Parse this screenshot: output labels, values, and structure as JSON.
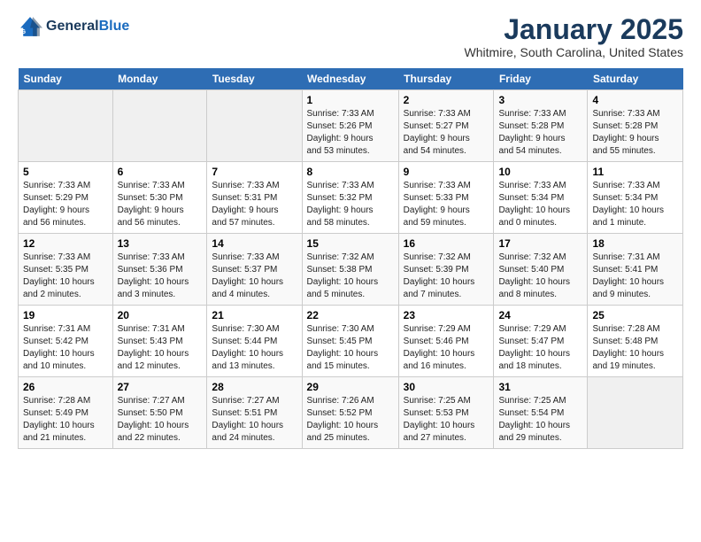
{
  "header": {
    "logo_line1": "General",
    "logo_line2": "Blue",
    "month_title": "January 2025",
    "location": "Whitmire, South Carolina, United States"
  },
  "weekdays": [
    "Sunday",
    "Monday",
    "Tuesday",
    "Wednesday",
    "Thursday",
    "Friday",
    "Saturday"
  ],
  "weeks": [
    [
      {
        "num": "",
        "info": ""
      },
      {
        "num": "",
        "info": ""
      },
      {
        "num": "",
        "info": ""
      },
      {
        "num": "1",
        "info": "Sunrise: 7:33 AM\nSunset: 5:26 PM\nDaylight: 9 hours\nand 53 minutes."
      },
      {
        "num": "2",
        "info": "Sunrise: 7:33 AM\nSunset: 5:27 PM\nDaylight: 9 hours\nand 54 minutes."
      },
      {
        "num": "3",
        "info": "Sunrise: 7:33 AM\nSunset: 5:28 PM\nDaylight: 9 hours\nand 54 minutes."
      },
      {
        "num": "4",
        "info": "Sunrise: 7:33 AM\nSunset: 5:28 PM\nDaylight: 9 hours\nand 55 minutes."
      }
    ],
    [
      {
        "num": "5",
        "info": "Sunrise: 7:33 AM\nSunset: 5:29 PM\nDaylight: 9 hours\nand 56 minutes."
      },
      {
        "num": "6",
        "info": "Sunrise: 7:33 AM\nSunset: 5:30 PM\nDaylight: 9 hours\nand 56 minutes."
      },
      {
        "num": "7",
        "info": "Sunrise: 7:33 AM\nSunset: 5:31 PM\nDaylight: 9 hours\nand 57 minutes."
      },
      {
        "num": "8",
        "info": "Sunrise: 7:33 AM\nSunset: 5:32 PM\nDaylight: 9 hours\nand 58 minutes."
      },
      {
        "num": "9",
        "info": "Sunrise: 7:33 AM\nSunset: 5:33 PM\nDaylight: 9 hours\nand 59 minutes."
      },
      {
        "num": "10",
        "info": "Sunrise: 7:33 AM\nSunset: 5:34 PM\nDaylight: 10 hours\nand 0 minutes."
      },
      {
        "num": "11",
        "info": "Sunrise: 7:33 AM\nSunset: 5:34 PM\nDaylight: 10 hours\nand 1 minute."
      }
    ],
    [
      {
        "num": "12",
        "info": "Sunrise: 7:33 AM\nSunset: 5:35 PM\nDaylight: 10 hours\nand 2 minutes."
      },
      {
        "num": "13",
        "info": "Sunrise: 7:33 AM\nSunset: 5:36 PM\nDaylight: 10 hours\nand 3 minutes."
      },
      {
        "num": "14",
        "info": "Sunrise: 7:33 AM\nSunset: 5:37 PM\nDaylight: 10 hours\nand 4 minutes."
      },
      {
        "num": "15",
        "info": "Sunrise: 7:32 AM\nSunset: 5:38 PM\nDaylight: 10 hours\nand 5 minutes."
      },
      {
        "num": "16",
        "info": "Sunrise: 7:32 AM\nSunset: 5:39 PM\nDaylight: 10 hours\nand 7 minutes."
      },
      {
        "num": "17",
        "info": "Sunrise: 7:32 AM\nSunset: 5:40 PM\nDaylight: 10 hours\nand 8 minutes."
      },
      {
        "num": "18",
        "info": "Sunrise: 7:31 AM\nSunset: 5:41 PM\nDaylight: 10 hours\nand 9 minutes."
      }
    ],
    [
      {
        "num": "19",
        "info": "Sunrise: 7:31 AM\nSunset: 5:42 PM\nDaylight: 10 hours\nand 10 minutes."
      },
      {
        "num": "20",
        "info": "Sunrise: 7:31 AM\nSunset: 5:43 PM\nDaylight: 10 hours\nand 12 minutes."
      },
      {
        "num": "21",
        "info": "Sunrise: 7:30 AM\nSunset: 5:44 PM\nDaylight: 10 hours\nand 13 minutes."
      },
      {
        "num": "22",
        "info": "Sunrise: 7:30 AM\nSunset: 5:45 PM\nDaylight: 10 hours\nand 15 minutes."
      },
      {
        "num": "23",
        "info": "Sunrise: 7:29 AM\nSunset: 5:46 PM\nDaylight: 10 hours\nand 16 minutes."
      },
      {
        "num": "24",
        "info": "Sunrise: 7:29 AM\nSunset: 5:47 PM\nDaylight: 10 hours\nand 18 minutes."
      },
      {
        "num": "25",
        "info": "Sunrise: 7:28 AM\nSunset: 5:48 PM\nDaylight: 10 hours\nand 19 minutes."
      }
    ],
    [
      {
        "num": "26",
        "info": "Sunrise: 7:28 AM\nSunset: 5:49 PM\nDaylight: 10 hours\nand 21 minutes."
      },
      {
        "num": "27",
        "info": "Sunrise: 7:27 AM\nSunset: 5:50 PM\nDaylight: 10 hours\nand 22 minutes."
      },
      {
        "num": "28",
        "info": "Sunrise: 7:27 AM\nSunset: 5:51 PM\nDaylight: 10 hours\nand 24 minutes."
      },
      {
        "num": "29",
        "info": "Sunrise: 7:26 AM\nSunset: 5:52 PM\nDaylight: 10 hours\nand 25 minutes."
      },
      {
        "num": "30",
        "info": "Sunrise: 7:25 AM\nSunset: 5:53 PM\nDaylight: 10 hours\nand 27 minutes."
      },
      {
        "num": "31",
        "info": "Sunrise: 7:25 AM\nSunset: 5:54 PM\nDaylight: 10 hours\nand 29 minutes."
      },
      {
        "num": "",
        "info": ""
      }
    ]
  ]
}
